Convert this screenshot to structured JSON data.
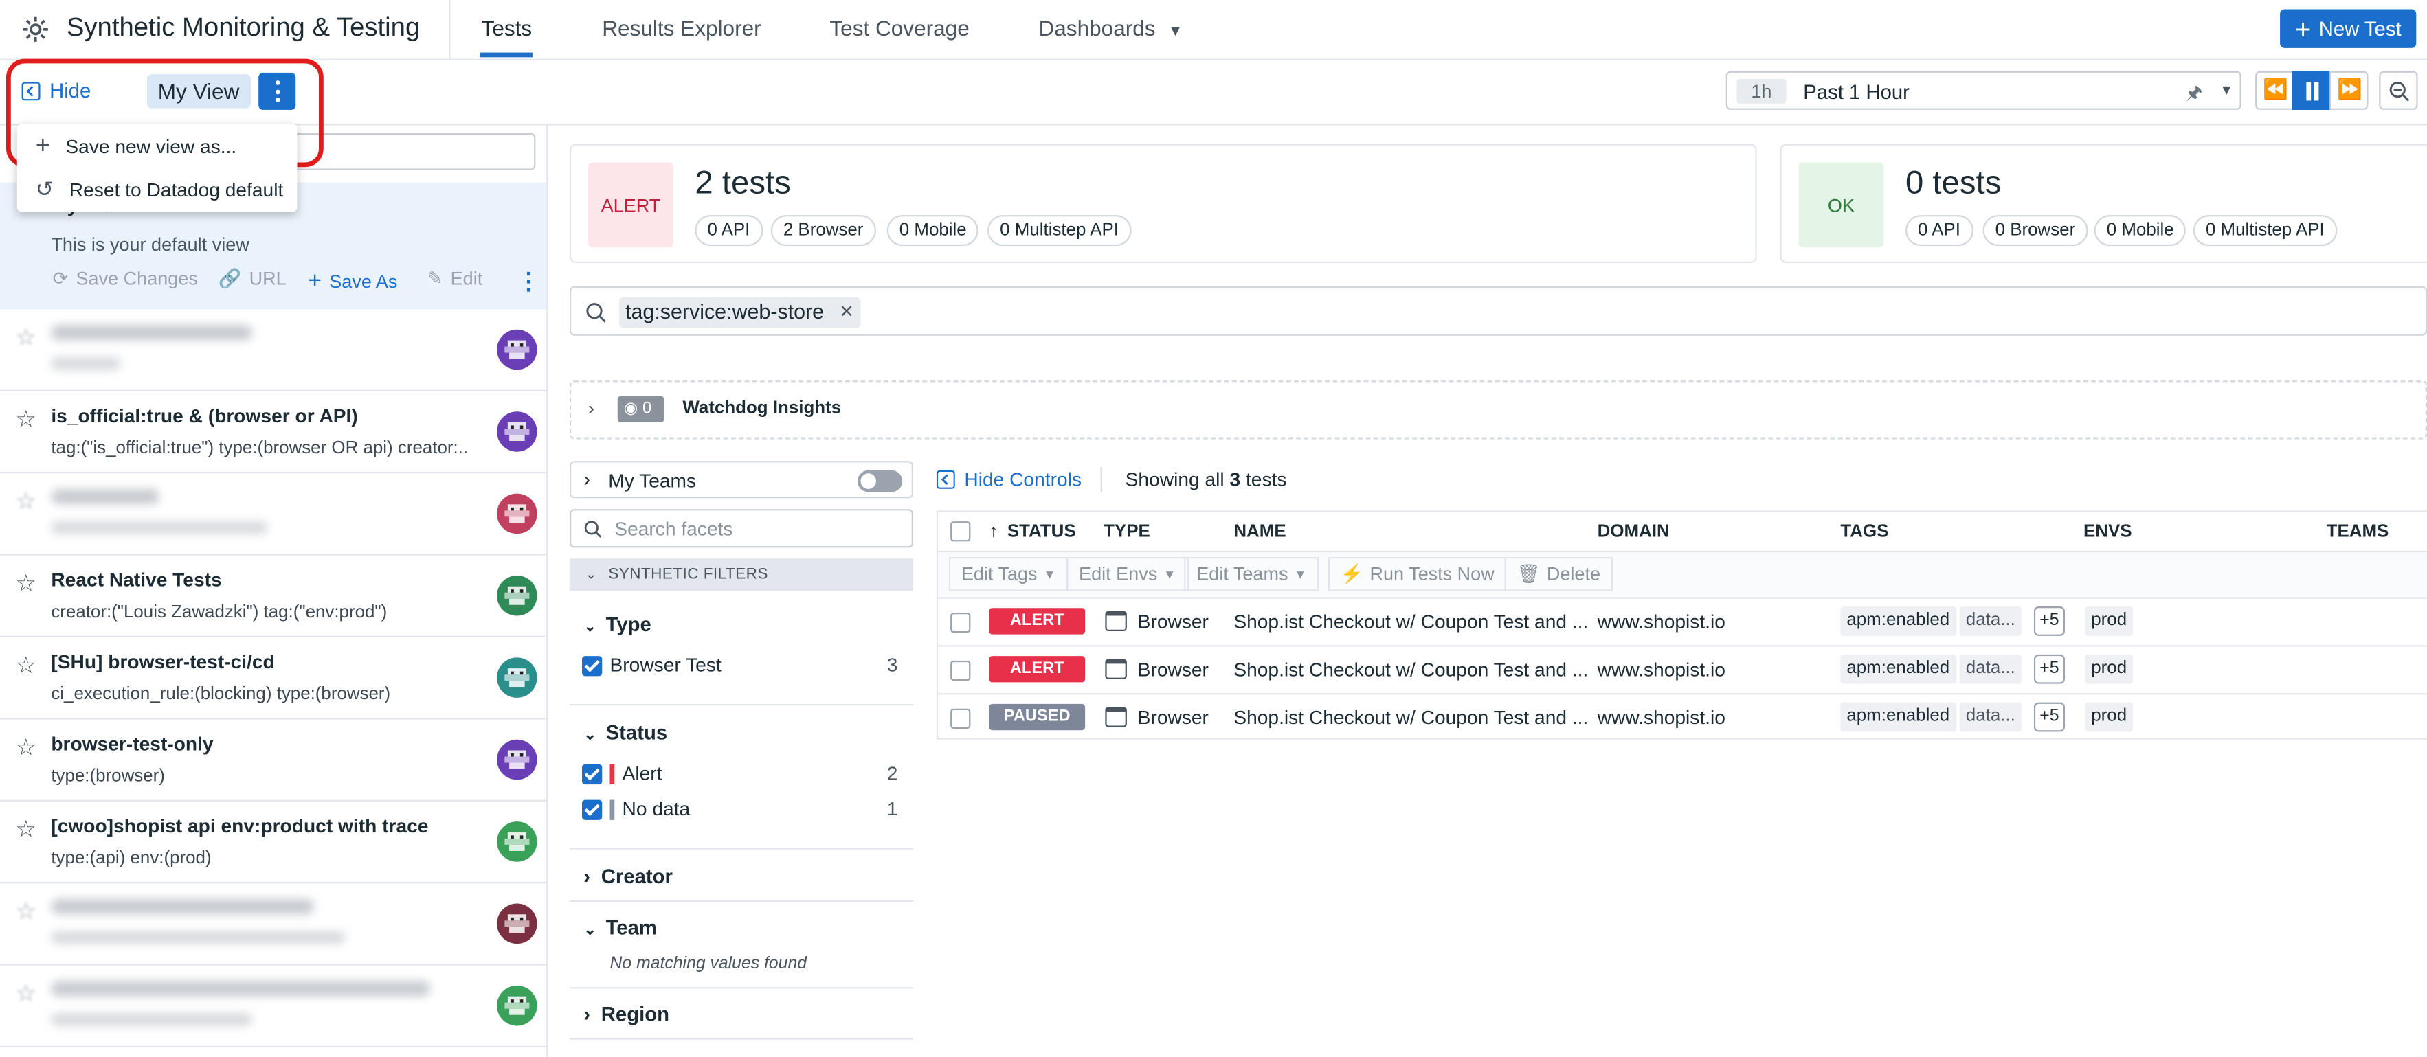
{
  "header": {
    "app_title": "Synthetic Monitoring & Testing",
    "tabs": [
      "Tests",
      "Results Explorer",
      "Test Coverage",
      "Dashboards"
    ],
    "new_test_label": "New Test"
  },
  "viewbar": {
    "hide_label": "Hide",
    "view_name": "My View",
    "menu": [
      "Save new view as...",
      "Reset to Datadog default"
    ]
  },
  "timepicker": {
    "chip": "1h",
    "label": "Past 1 Hour"
  },
  "sidebar": {
    "active_view": {
      "title": "My View",
      "subtitle": "This is your default view",
      "actions": [
        "Save Changes",
        "URL",
        "Save As",
        "Edit"
      ]
    },
    "views": [
      {
        "title": "",
        "subtitle": "",
        "blurred": true
      },
      {
        "title": "is_official:true & (browser or API)",
        "subtitle": "tag:(\"is_official:true\") type:(browser OR api) creator:...",
        "blurred": false
      },
      {
        "title": "",
        "subtitle": "",
        "blurred": true
      },
      {
        "title": "React Native Tests",
        "subtitle": "creator:(\"Louis Zawadzki\") tag:(\"env:prod\")",
        "blurred": false
      },
      {
        "title": "[SHu] browser-test-ci/cd",
        "subtitle": "ci_execution_rule:(blocking) type:(browser)",
        "blurred": false
      },
      {
        "title": "browser-test-only",
        "subtitle": "type:(browser)",
        "blurred": false
      },
      {
        "title": "[cwoo]shopist api env:product with trace",
        "subtitle": "type:(api) env:(prod)",
        "blurred": false
      },
      {
        "title": "",
        "subtitle": "",
        "blurred": true
      },
      {
        "title": "",
        "subtitle": "",
        "blurred": true
      }
    ],
    "avatar_colors": [
      "#6a3fb5",
      "#6a3fb5",
      "#c0405f",
      "#2e8b57",
      "#2a8f8a",
      "#6a3fb5",
      "#3aa05a",
      "#7a3040",
      "#3aa05a"
    ]
  },
  "summary": {
    "alert": {
      "status": "ALERT",
      "count": "2 tests",
      "pills": [
        "0 API",
        "2 Browser",
        "0 Mobile",
        "0 Multistep API"
      ]
    },
    "ok": {
      "status": "OK",
      "count": "0 tests",
      "pills": [
        "0 API",
        "0 Browser",
        "0 Mobile",
        "0 Multistep API"
      ]
    }
  },
  "search": {
    "tag": "tag:service:web-store"
  },
  "watchdog": {
    "count": "0",
    "label": "Watchdog Insights"
  },
  "facets": {
    "my_teams": "My Teams",
    "search_placeholder": "Search facets",
    "synthetic_filters": "SYNTHETIC FILTERS",
    "type": {
      "label": "Type",
      "items": [
        {
          "name": "Browser Test",
          "count": "3"
        }
      ]
    },
    "status": {
      "label": "Status",
      "items": [
        {
          "name": "Alert",
          "count": "2",
          "color": "#e8304a"
        },
        {
          "name": "No data",
          "count": "1",
          "color": "#8a94a6"
        }
      ]
    },
    "creator": "Creator",
    "team": {
      "label": "Team",
      "empty": "No matching values found"
    },
    "region": "Region"
  },
  "controls": {
    "hide_controls": "Hide Controls",
    "showing_prefix": "Showing all ",
    "showing_count": "3",
    "showing_suffix": " tests"
  },
  "table": {
    "headers": [
      "STATUS",
      "TYPE",
      "NAME",
      "DOMAIN",
      "TAGS",
      "ENVS",
      "TEAMS"
    ],
    "bulk_actions": [
      "Edit Tags",
      "Edit Envs",
      "Edit Teams",
      "Run Tests Now",
      "Delete"
    ],
    "rows": [
      {
        "status": "ALERT",
        "status_color": "#e8304a",
        "type": "Browser",
        "name": "Shop.ist Checkout w/ Coupon Test and ...",
        "domain": "www.shopist.io",
        "tag1": "apm:enabled",
        "tag2": "data...",
        "more": "+5",
        "env": "prod"
      },
      {
        "status": "ALERT",
        "status_color": "#e8304a",
        "type": "Browser",
        "name": "Shop.ist Checkout w/ Coupon Test and ...",
        "domain": "www.shopist.io",
        "tag1": "apm:enabled",
        "tag2": "data...",
        "more": "+5",
        "env": "prod"
      },
      {
        "status": "PAUSED",
        "status_color": "#7d8799",
        "type": "Browser",
        "name": "Shop.ist Checkout w/ Coupon Test and ...",
        "domain": "www.shopist.io",
        "tag1": "apm:enabled",
        "tag2": "data...",
        "more": "+5",
        "env": "prod"
      }
    ]
  },
  "colors": {
    "accent": "#1a6ecc",
    "alert": "#e8304a",
    "ok": "#2e8b3e",
    "highlight_ring": "#e21b1b"
  }
}
